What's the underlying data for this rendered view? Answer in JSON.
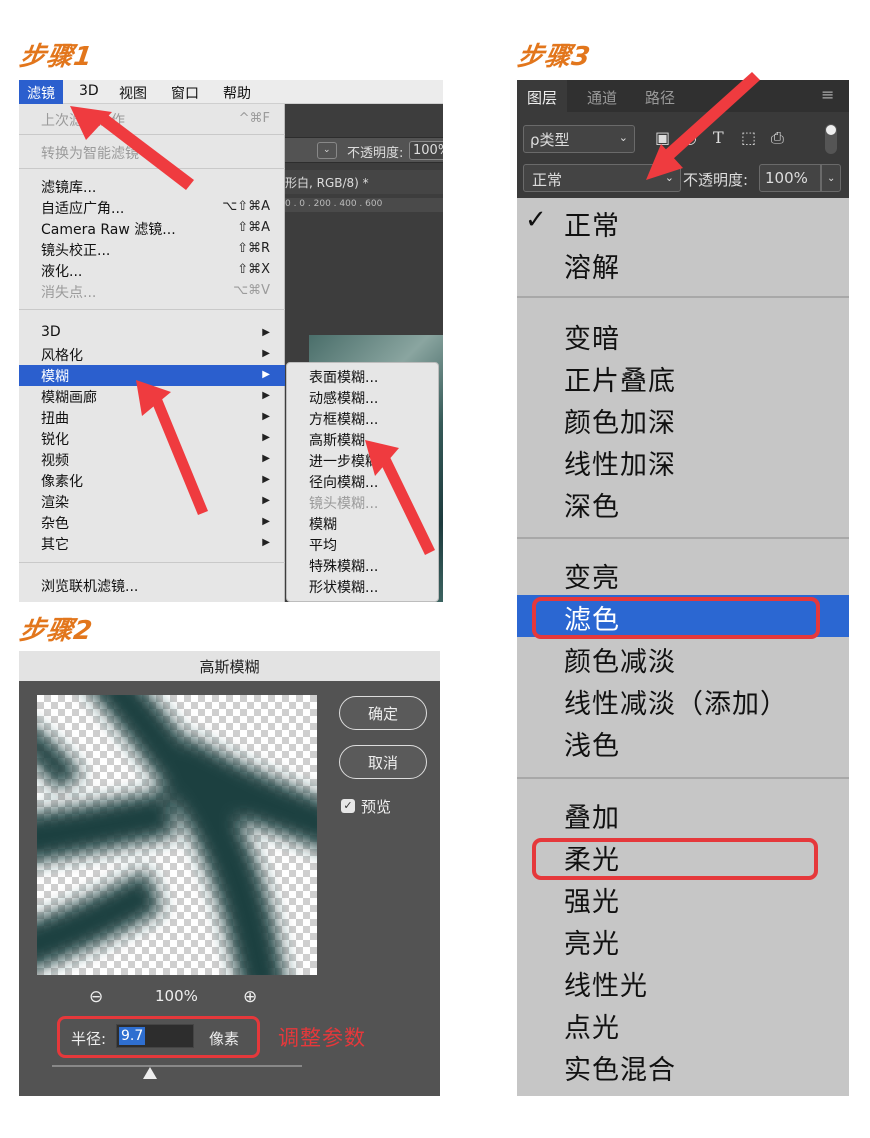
{
  "steps": {
    "step1": "步骤1",
    "step2": "步骤2",
    "step3": "步骤3"
  },
  "step1": {
    "menubar": [
      "滤镜",
      "3D",
      "视图",
      "窗口",
      "帮助"
    ],
    "options_bar": {
      "opacity_label": "不透明度:",
      "opacity_value": "100%"
    },
    "doc_tab": "形白, RGB/8) *",
    "ruler": "0 . 0 . 200 . 400 . 600",
    "menu": {
      "last_filter": {
        "label": "上次滤镜操作",
        "shortcut": "^⌘F"
      },
      "smart": "转换为智能滤镜",
      "gallery": "滤镜库...",
      "adaptive": {
        "label": "自适应广角...",
        "shortcut": "⌥⇧⌘A"
      },
      "camera_raw": {
        "label": "Camera Raw 滤镜...",
        "shortcut": "⇧⌘A"
      },
      "lens": {
        "label": "镜头校正...",
        "shortcut": "⇧⌘R"
      },
      "liquify": {
        "label": "液化...",
        "shortcut": "⇧⌘X"
      },
      "vanishing": {
        "label": "消失点...",
        "shortcut": "⌥⌘V"
      },
      "groups": [
        "3D",
        "风格化",
        "模糊",
        "模糊画廊",
        "扭曲",
        "锐化",
        "视频",
        "像素化",
        "渲染",
        "杂色",
        "其它"
      ],
      "browse": "浏览联机滤镜..."
    },
    "submenu": [
      "表面模糊...",
      "动感模糊...",
      "方框模糊...",
      "高斯模糊...",
      "进一步模糊",
      "径向模糊...",
      "镜头模糊...",
      "模糊",
      "平均",
      "特殊模糊...",
      "形状模糊..."
    ]
  },
  "step2": {
    "title": "高斯模糊",
    "ok": "确定",
    "cancel": "取消",
    "preview_label": "预览",
    "zoom": "100%",
    "radius_label": "半径:",
    "radius_value": "9.7",
    "unit": "像素",
    "annotation": "调整参数"
  },
  "step3": {
    "tabs": [
      "图层",
      "通道",
      "路径"
    ],
    "filter_label": "ρ类型",
    "blend_current": "正常",
    "opacity_label": "不透明度:",
    "opacity_value": "100%",
    "group1": [
      "正常",
      "溶解"
    ],
    "group2": [
      "变暗",
      "正片叠底",
      "颜色加深",
      "线性加深",
      "深色"
    ],
    "group3": [
      "变亮",
      "滤色",
      "颜色减淡",
      "线性减淡（添加）",
      "浅色"
    ],
    "group4": [
      "叠加",
      "柔光",
      "强光",
      "亮光",
      "线性光",
      "点光",
      "实色混合"
    ]
  },
  "colors": {
    "accent_red": "#e5383b",
    "menu_highlight": "#2b5fce",
    "step_title": "#e2761c"
  }
}
